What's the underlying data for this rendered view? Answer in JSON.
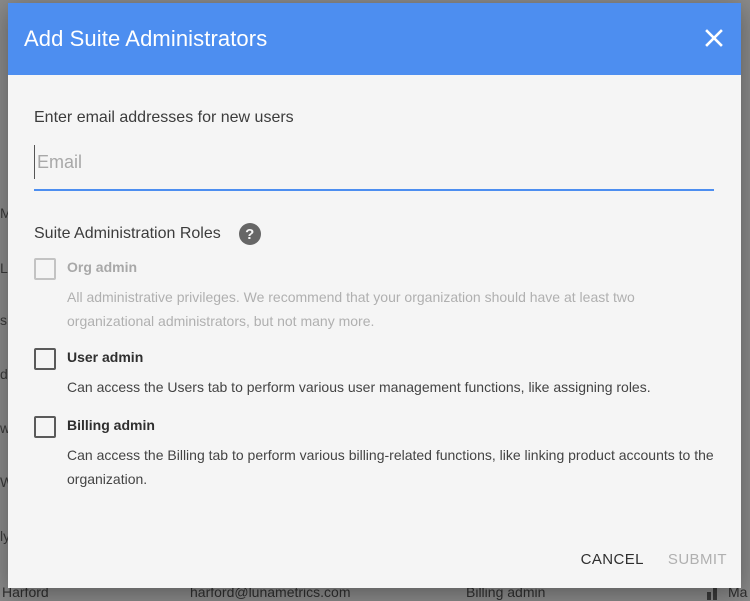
{
  "dialog": {
    "title": "Add Suite Administrators",
    "email_label": "Enter email addresses for new users",
    "email_placeholder": "Email",
    "email_value": "",
    "roles_heading": "Suite Administration Roles",
    "roles": [
      {
        "name": "Org admin",
        "description": "All administrative privileges. We recommend that your organization should have at least two organizational administrators, but not many more.",
        "checked": false,
        "disabled": true
      },
      {
        "name": "User admin",
        "description": "Can access the Users tab to perform various user management functions, like assigning roles.",
        "checked": false,
        "disabled": false
      },
      {
        "name": "Billing admin",
        "description": "Can access the Billing tab to perform various billing-related functions, like linking product accounts to the organization.",
        "checked": false,
        "disabled": false
      }
    ],
    "cancel_label": "CANCEL",
    "submit_label": "SUBMIT"
  },
  "background_row": {
    "name": "Harford",
    "email": "harford@lunametrics.com",
    "role": "Billing admin",
    "extra": "Ma"
  },
  "colors": {
    "header": "#4d8ef0",
    "dialog_bg": "#f5f5f5"
  }
}
